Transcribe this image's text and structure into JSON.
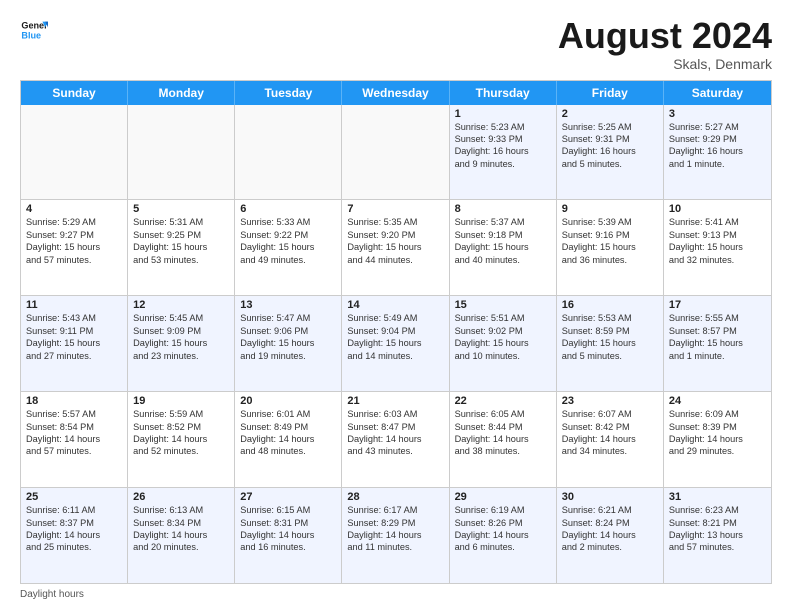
{
  "logo": {
    "text_general": "General",
    "text_blue": "Blue"
  },
  "title": "August 2024",
  "subtitle": "Skals, Denmark",
  "weekdays": [
    "Sunday",
    "Monday",
    "Tuesday",
    "Wednesday",
    "Thursday",
    "Friday",
    "Saturday"
  ],
  "footer_text": "Daylight hours",
  "rows": [
    [
      {
        "day": "",
        "info": "",
        "empty": true
      },
      {
        "day": "",
        "info": "",
        "empty": true
      },
      {
        "day": "",
        "info": "",
        "empty": true
      },
      {
        "day": "",
        "info": "",
        "empty": true
      },
      {
        "day": "1",
        "info": "Sunrise: 5:23 AM\nSunset: 9:33 PM\nDaylight: 16 hours\nand 9 minutes."
      },
      {
        "day": "2",
        "info": "Sunrise: 5:25 AM\nSunset: 9:31 PM\nDaylight: 16 hours\nand 5 minutes."
      },
      {
        "day": "3",
        "info": "Sunrise: 5:27 AM\nSunset: 9:29 PM\nDaylight: 16 hours\nand 1 minute."
      }
    ],
    [
      {
        "day": "4",
        "info": "Sunrise: 5:29 AM\nSunset: 9:27 PM\nDaylight: 15 hours\nand 57 minutes."
      },
      {
        "day": "5",
        "info": "Sunrise: 5:31 AM\nSunset: 9:25 PM\nDaylight: 15 hours\nand 53 minutes."
      },
      {
        "day": "6",
        "info": "Sunrise: 5:33 AM\nSunset: 9:22 PM\nDaylight: 15 hours\nand 49 minutes."
      },
      {
        "day": "7",
        "info": "Sunrise: 5:35 AM\nSunset: 9:20 PM\nDaylight: 15 hours\nand 44 minutes."
      },
      {
        "day": "8",
        "info": "Sunrise: 5:37 AM\nSunset: 9:18 PM\nDaylight: 15 hours\nand 40 minutes."
      },
      {
        "day": "9",
        "info": "Sunrise: 5:39 AM\nSunset: 9:16 PM\nDaylight: 15 hours\nand 36 minutes."
      },
      {
        "day": "10",
        "info": "Sunrise: 5:41 AM\nSunset: 9:13 PM\nDaylight: 15 hours\nand 32 minutes."
      }
    ],
    [
      {
        "day": "11",
        "info": "Sunrise: 5:43 AM\nSunset: 9:11 PM\nDaylight: 15 hours\nand 27 minutes."
      },
      {
        "day": "12",
        "info": "Sunrise: 5:45 AM\nSunset: 9:09 PM\nDaylight: 15 hours\nand 23 minutes."
      },
      {
        "day": "13",
        "info": "Sunrise: 5:47 AM\nSunset: 9:06 PM\nDaylight: 15 hours\nand 19 minutes."
      },
      {
        "day": "14",
        "info": "Sunrise: 5:49 AM\nSunset: 9:04 PM\nDaylight: 15 hours\nand 14 minutes."
      },
      {
        "day": "15",
        "info": "Sunrise: 5:51 AM\nSunset: 9:02 PM\nDaylight: 15 hours\nand 10 minutes."
      },
      {
        "day": "16",
        "info": "Sunrise: 5:53 AM\nSunset: 8:59 PM\nDaylight: 15 hours\nand 5 minutes."
      },
      {
        "day": "17",
        "info": "Sunrise: 5:55 AM\nSunset: 8:57 PM\nDaylight: 15 hours\nand 1 minute."
      }
    ],
    [
      {
        "day": "18",
        "info": "Sunrise: 5:57 AM\nSunset: 8:54 PM\nDaylight: 14 hours\nand 57 minutes."
      },
      {
        "day": "19",
        "info": "Sunrise: 5:59 AM\nSunset: 8:52 PM\nDaylight: 14 hours\nand 52 minutes."
      },
      {
        "day": "20",
        "info": "Sunrise: 6:01 AM\nSunset: 8:49 PM\nDaylight: 14 hours\nand 48 minutes."
      },
      {
        "day": "21",
        "info": "Sunrise: 6:03 AM\nSunset: 8:47 PM\nDaylight: 14 hours\nand 43 minutes."
      },
      {
        "day": "22",
        "info": "Sunrise: 6:05 AM\nSunset: 8:44 PM\nDaylight: 14 hours\nand 38 minutes."
      },
      {
        "day": "23",
        "info": "Sunrise: 6:07 AM\nSunset: 8:42 PM\nDaylight: 14 hours\nand 34 minutes."
      },
      {
        "day": "24",
        "info": "Sunrise: 6:09 AM\nSunset: 8:39 PM\nDaylight: 14 hours\nand 29 minutes."
      }
    ],
    [
      {
        "day": "25",
        "info": "Sunrise: 6:11 AM\nSunset: 8:37 PM\nDaylight: 14 hours\nand 25 minutes."
      },
      {
        "day": "26",
        "info": "Sunrise: 6:13 AM\nSunset: 8:34 PM\nDaylight: 14 hours\nand 20 minutes."
      },
      {
        "day": "27",
        "info": "Sunrise: 6:15 AM\nSunset: 8:31 PM\nDaylight: 14 hours\nand 16 minutes."
      },
      {
        "day": "28",
        "info": "Sunrise: 6:17 AM\nSunset: 8:29 PM\nDaylight: 14 hours\nand 11 minutes."
      },
      {
        "day": "29",
        "info": "Sunrise: 6:19 AM\nSunset: 8:26 PM\nDaylight: 14 hours\nand 6 minutes."
      },
      {
        "day": "30",
        "info": "Sunrise: 6:21 AM\nSunset: 8:24 PM\nDaylight: 14 hours\nand 2 minutes."
      },
      {
        "day": "31",
        "info": "Sunrise: 6:23 AM\nSunset: 8:21 PM\nDaylight: 13 hours\nand 57 minutes."
      }
    ]
  ]
}
